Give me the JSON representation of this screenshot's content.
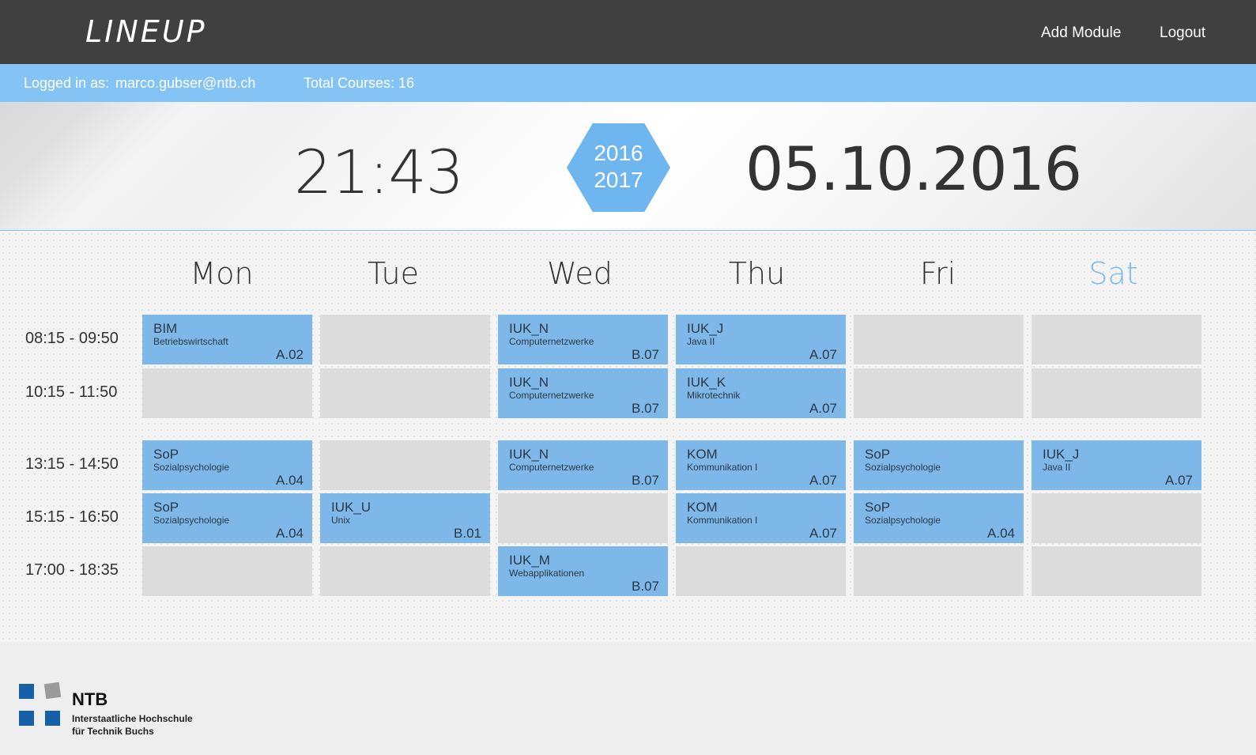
{
  "app": {
    "logo": "LINEUP",
    "nav": {
      "add_module": "Add Module",
      "logout": "Logout"
    }
  },
  "info": {
    "logged_in_label": "Logged in as:",
    "user_email": "marco.gubser@ntb.ch",
    "total_courses": "Total Courses: 16"
  },
  "header": {
    "time": "21:43",
    "year_start": "2016",
    "year_end": "2017",
    "date": "05.10.2016"
  },
  "schedule": {
    "days": [
      "Mon",
      "Tue",
      "Wed",
      "Thu",
      "Fri",
      "Sat"
    ],
    "today": "Sat",
    "slots": [
      "08:15 - 09:50",
      "10:15 - 11:50",
      "13:15 - 14:50",
      "15:15 - 16:50",
      "17:00 - 18:35"
    ],
    "grid": [
      [
        {
          "code": "BIM",
          "name": "Betriebswirtschaft",
          "room": "A.02"
        },
        null,
        {
          "code": "IUK_N",
          "name": "Computernetzwerke",
          "room": "B.07"
        },
        {
          "code": "IUK_J",
          "name": "Java II",
          "room": "A.07"
        },
        null,
        null
      ],
      [
        null,
        null,
        {
          "code": "IUK_N",
          "name": "Computernetzwerke",
          "room": "B.07"
        },
        {
          "code": "IUK_K",
          "name": "Mikrotechnik",
          "room": "A.07"
        },
        null,
        null
      ],
      [
        {
          "code": "SoP",
          "name": "Sozialpsychologie",
          "room": "A.04"
        },
        null,
        {
          "code": "IUK_N",
          "name": "Computernetzwerke",
          "room": "B.07"
        },
        {
          "code": "KOM",
          "name": "Kommunikation I",
          "room": "A.07"
        },
        {
          "code": "SoP",
          "name": "Sozialpsychologie",
          "room": ""
        },
        {
          "code": "IUK_J",
          "name": "Java II",
          "room": "A.07"
        }
      ],
      [
        {
          "code": "SoP",
          "name": "Sozialpsychologie",
          "room": "A.04"
        },
        {
          "code": "IUK_U",
          "name": "Unix",
          "room": "B.01"
        },
        null,
        {
          "code": "KOM",
          "name": "Kommunikation I",
          "room": "A.07"
        },
        {
          "code": "SoP",
          "name": "Sozialpsychologie",
          "room": "A.04"
        },
        null
      ],
      [
        null,
        null,
        {
          "code": "IUK_M",
          "name": "Webapplikationen",
          "room": "B.07"
        },
        null,
        null,
        null
      ]
    ]
  },
  "footer": {
    "org_short": "NTB",
    "org_line1": "Interstaatliche Hochschule",
    "org_line2": "für Technik Buchs",
    "colors": {
      "blue": "#1560a8",
      "gray": "#9a9a9a"
    }
  }
}
